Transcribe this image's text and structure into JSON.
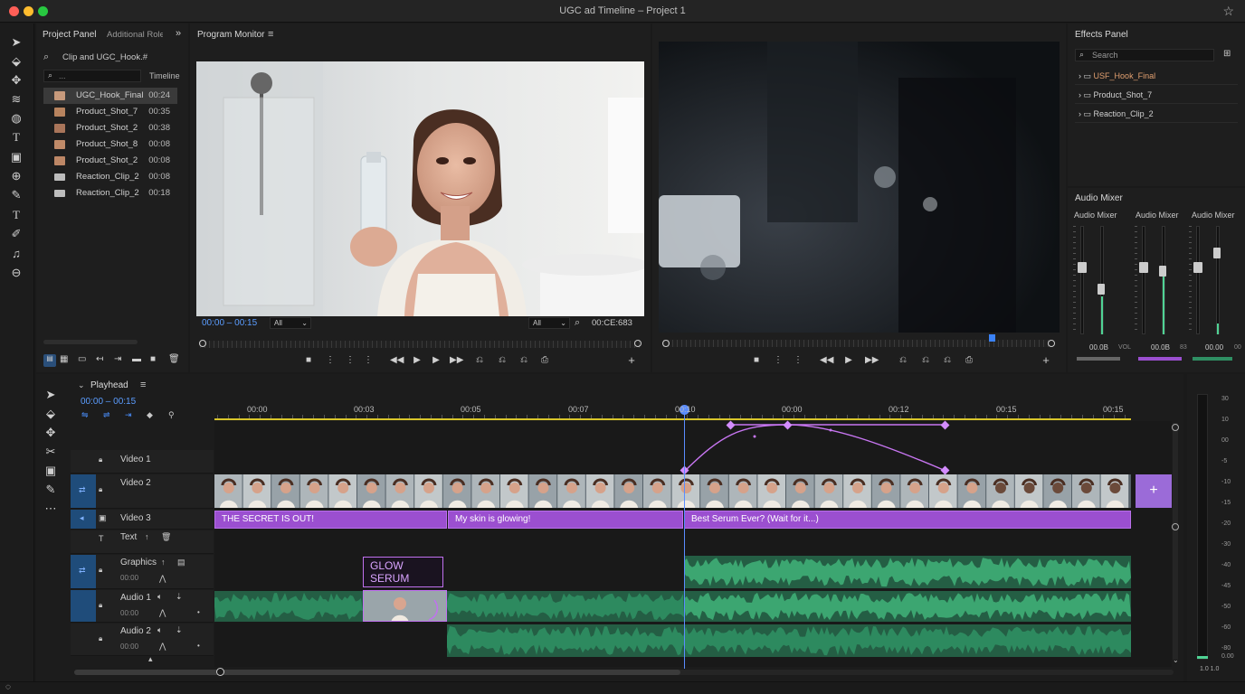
{
  "window": {
    "title": "UGC ad Timeline – Project 1",
    "traffic_colors": [
      "#ff5f57",
      "#febc2e",
      "#28c840"
    ]
  },
  "project_panel": {
    "tabs": [
      "Project Panel",
      "Additional Role"
    ],
    "search_value": "Clip and UGC_Hook.#",
    "filter_value": "...",
    "filter_label": "Timeline",
    "items": [
      {
        "name": "UGC_Hook_Final",
        "duration": "00:24",
        "kind": "video"
      },
      {
        "name": "Product_Shot_7",
        "duration": "00:35",
        "kind": "video"
      },
      {
        "name": "Product_Shot_2",
        "duration": "00:38",
        "kind": "video"
      },
      {
        "name": "Product_Shot_8",
        "duration": "00:08",
        "kind": "video"
      },
      {
        "name": "Product_Shot_2",
        "duration": "00:08",
        "kind": "video"
      },
      {
        "name": "Reaction_Clip_2",
        "duration": "00:08",
        "kind": "folder"
      },
      {
        "name": "Reaction_Clip_2",
        "duration": "00:18",
        "kind": "folder"
      }
    ]
  },
  "program_monitor": {
    "title": "Program Monitor",
    "timecode": "00:00 – 00:15",
    "zoom_select": "All",
    "quality_select": "All",
    "duration": "00:CE:683"
  },
  "effects_panel": {
    "title": "Effects Panel",
    "search_placeholder": "Search",
    "items": [
      "USF_Hook_Final",
      "Product_Shot_7",
      "Reaction_Clip_2"
    ]
  },
  "audio_mixer": {
    "title": "Audio Mixer",
    "channels": [
      {
        "label": "Audio Mixer",
        "value": "00.0B",
        "unit": "VOL",
        "level": 0.35
      },
      {
        "label": "Audio Mixer",
        "value": "00.0B",
        "unit": "83",
        "level": 0.55
      },
      {
        "label": "Audio Mixer",
        "value": "00.00",
        "unit": "00",
        "level": 0.1
      }
    ]
  },
  "timeline": {
    "playhead_label": "Playhead",
    "timecode": "00:00 – 00:15",
    "ruler": [
      "00:00",
      "00:03",
      "00:05",
      "00:07",
      "00:10",
      "00:00",
      "00:12",
      "00:15",
      "00:15"
    ],
    "tracks": {
      "video1": "Video 1",
      "video2": "Video 2",
      "video3": "Video 3",
      "text": "Text",
      "graphics": "Graphics",
      "graphics_time": "00:00",
      "audio1": "Audio 1",
      "audio1_time": "00:00",
      "audio2": "Audio 2",
      "audio2_time": "00:00"
    },
    "caption_clips": [
      "THE SECRET IS OUT!",
      "My skin is glowing!",
      "Best Serum Ever? (Wait for it...)"
    ],
    "graphic_label_line1": "GLOW",
    "graphic_label_line2": "SERUM",
    "colors": {
      "caption": "#9b4fd0",
      "audio": "#2f8f63",
      "audio_bright": "#4fd394",
      "keyframe": "#c876f2",
      "playhead": "#5a8cff"
    }
  },
  "meter_scale": [
    "30",
    "10",
    "00",
    "-5",
    "-10",
    "-15",
    "-20",
    "-30",
    "-40",
    "-45",
    "-50",
    "-60",
    "-80",
    "0.00"
  ],
  "meter_footer": "1.0 1.0"
}
